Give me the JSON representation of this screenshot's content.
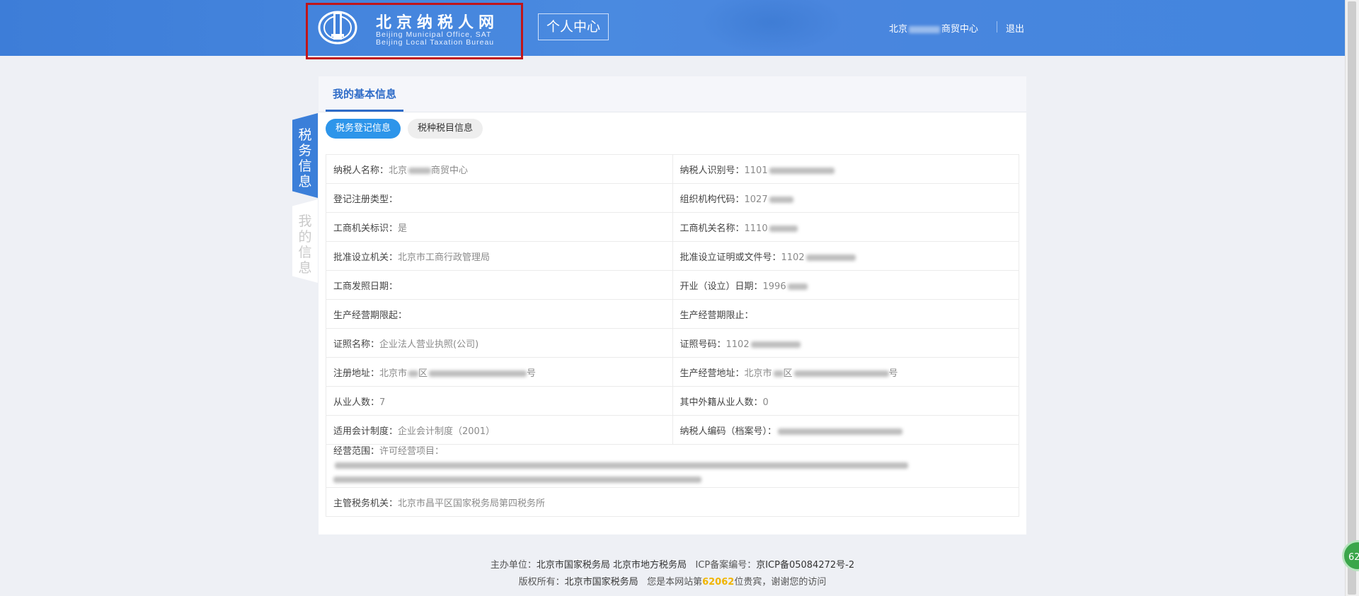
{
  "header": {
    "logo_cn": "北京纳税人网",
    "logo_en_line1": "Beijing Municipal Office, SAT",
    "logo_en_line2": "Beijing Local Taxation Bureau",
    "center_button": "个人中心",
    "user_prefix": "北京",
    "user_suffix": "商贸中心",
    "logout": "退出"
  },
  "side_tabs": [
    {
      "label": "税务信息",
      "active": true
    },
    {
      "label": "我的信息",
      "active": false
    }
  ],
  "panel": {
    "title": "我的基本信息",
    "subtabs": [
      {
        "label": "税务登记信息",
        "active": true
      },
      {
        "label": "税种税目信息",
        "active": false
      }
    ]
  },
  "fields": {
    "taxpayer_name": {
      "label": "纳税人名称：",
      "value_prefix": "北京",
      "value_suffix": "商贸中心"
    },
    "taxpayer_id": {
      "label": "纳税人识别号：",
      "value_prefix": "1101"
    },
    "reg_type": {
      "label": "登记注册类型：",
      "value": ""
    },
    "org_code": {
      "label": "组织机构代码：",
      "value_prefix": "1027"
    },
    "biz_flag": {
      "label": "工商机关标识：",
      "value": "是"
    },
    "biz_name": {
      "label": "工商机关名称：",
      "value_prefix": "1110"
    },
    "approve_org": {
      "label": "批准设立机关：",
      "value": "北京市工商行政管理局"
    },
    "approve_doc": {
      "label": "批准设立证明或文件号：",
      "value_prefix": "1102"
    },
    "license_date": {
      "label": "工商发照日期：",
      "value": ""
    },
    "open_date": {
      "label": "开业（设立）日期：",
      "value_prefix": "1996"
    },
    "period_start": {
      "label": "生产经营期限起：",
      "value": ""
    },
    "period_end": {
      "label": "生产经营期限止：",
      "value": ""
    },
    "cert_name": {
      "label": "证照名称：",
      "value": "企业法人营业执照(公司)"
    },
    "cert_no": {
      "label": "证照号码：",
      "value_prefix": "1102"
    },
    "reg_addr": {
      "label": "注册地址：",
      "value_prefix": "北京市",
      "value_mid": "区",
      "value_suffix": "号"
    },
    "biz_addr": {
      "label": "生产经营地址：",
      "value_prefix": "北京市",
      "value_mid": "区",
      "value_suffix": "号"
    },
    "staff": {
      "label": "从业人数：",
      "value": "7"
    },
    "foreign_staff": {
      "label": "其中外籍从业人数：",
      "value": "0"
    },
    "accounting": {
      "label": "适用会计制度：",
      "value": "企业会计制度（2001）"
    },
    "taxpayer_code": {
      "label": "纳税人编码（档案号）：",
      "value": ""
    },
    "scope": {
      "label": "经营范围：",
      "value_prefix": "许可经营项目："
    },
    "tax_office": {
      "label": "主管税务机关：",
      "value": "北京市昌平区国家税务局第四税务所"
    }
  },
  "footer": {
    "line1_host_label": "主办单位：",
    "line1_host": "北京市国家税务局 北京市地方税务局",
    "line1_icp_label": "ICP备案编号：",
    "line1_icp": "京ICP备05084272号-2",
    "line2_copy_label": "版权所有：",
    "line2_copy": "北京市国家税务局",
    "line2_visit_prefix": "您是本网站第",
    "line2_visit_count": "62062",
    "line2_visit_suffix": "位贵宾，谢谢您的访问"
  },
  "badge_text": "62"
}
